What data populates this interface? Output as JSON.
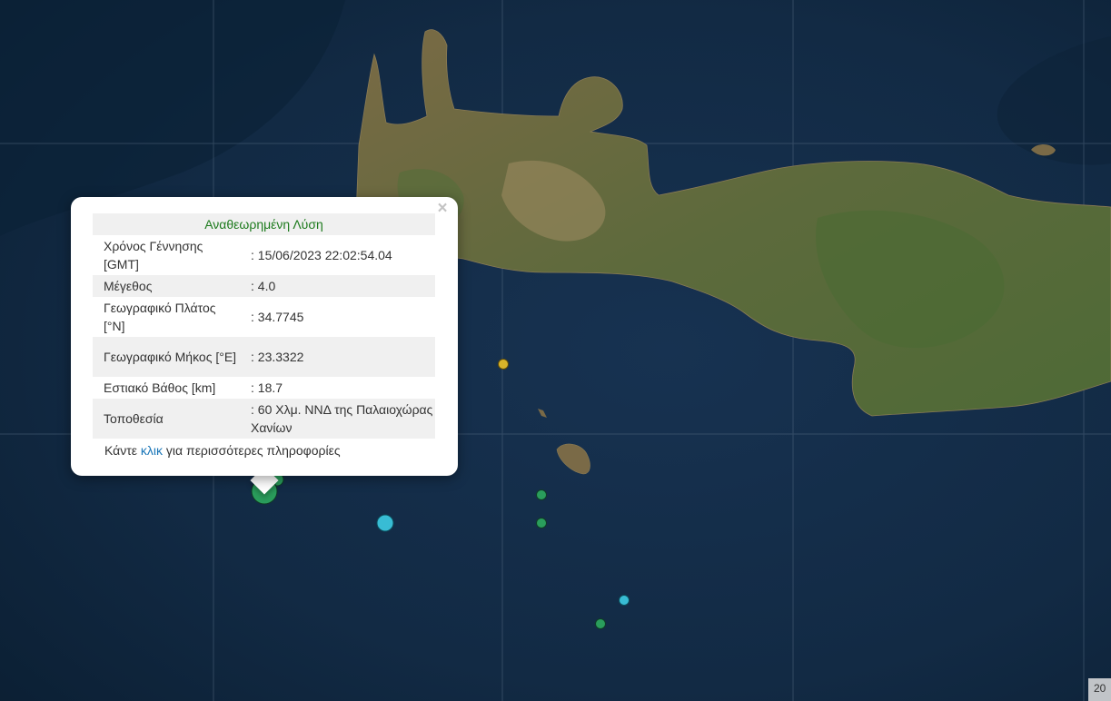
{
  "popup": {
    "title": "Αναθεωρημένη Λύση",
    "rows": [
      {
        "label": "Χρόνος Γέννησης [GMT]",
        "value": ": 15/06/2023 22:02:54.04"
      },
      {
        "label": "Μέγεθος",
        "value": ": 4.0"
      },
      {
        "label": "Γεωγραφικό Πλάτος [°N]",
        "value": ": 34.7745"
      },
      {
        "label": "Γεωγραφικό Μήκος [°E]",
        "value": ": 23.3322"
      },
      {
        "label": "Εστιακό Βάθος [km]",
        "value": ": 18.7"
      },
      {
        "label": "Τοποθεσία",
        "value": ": 60 Χλμ. ΝΝΔ της Παλαιοχώρας Χανίων"
      }
    ],
    "footer_prefix": "Κάντε ",
    "footer_link": "κλικ",
    "footer_suffix": " για περισσότερες πληροφορίες",
    "close_icon": "×"
  },
  "attribution": "20",
  "colors": {
    "sea": "#12283f",
    "land": "#6f6a3e",
    "marker_green": "#2a9d5c",
    "marker_cyan": "#38bcd4",
    "marker_yellow": "#d9b42a",
    "title_green": "#1c7a1c",
    "link_blue": "#1a76b8"
  }
}
